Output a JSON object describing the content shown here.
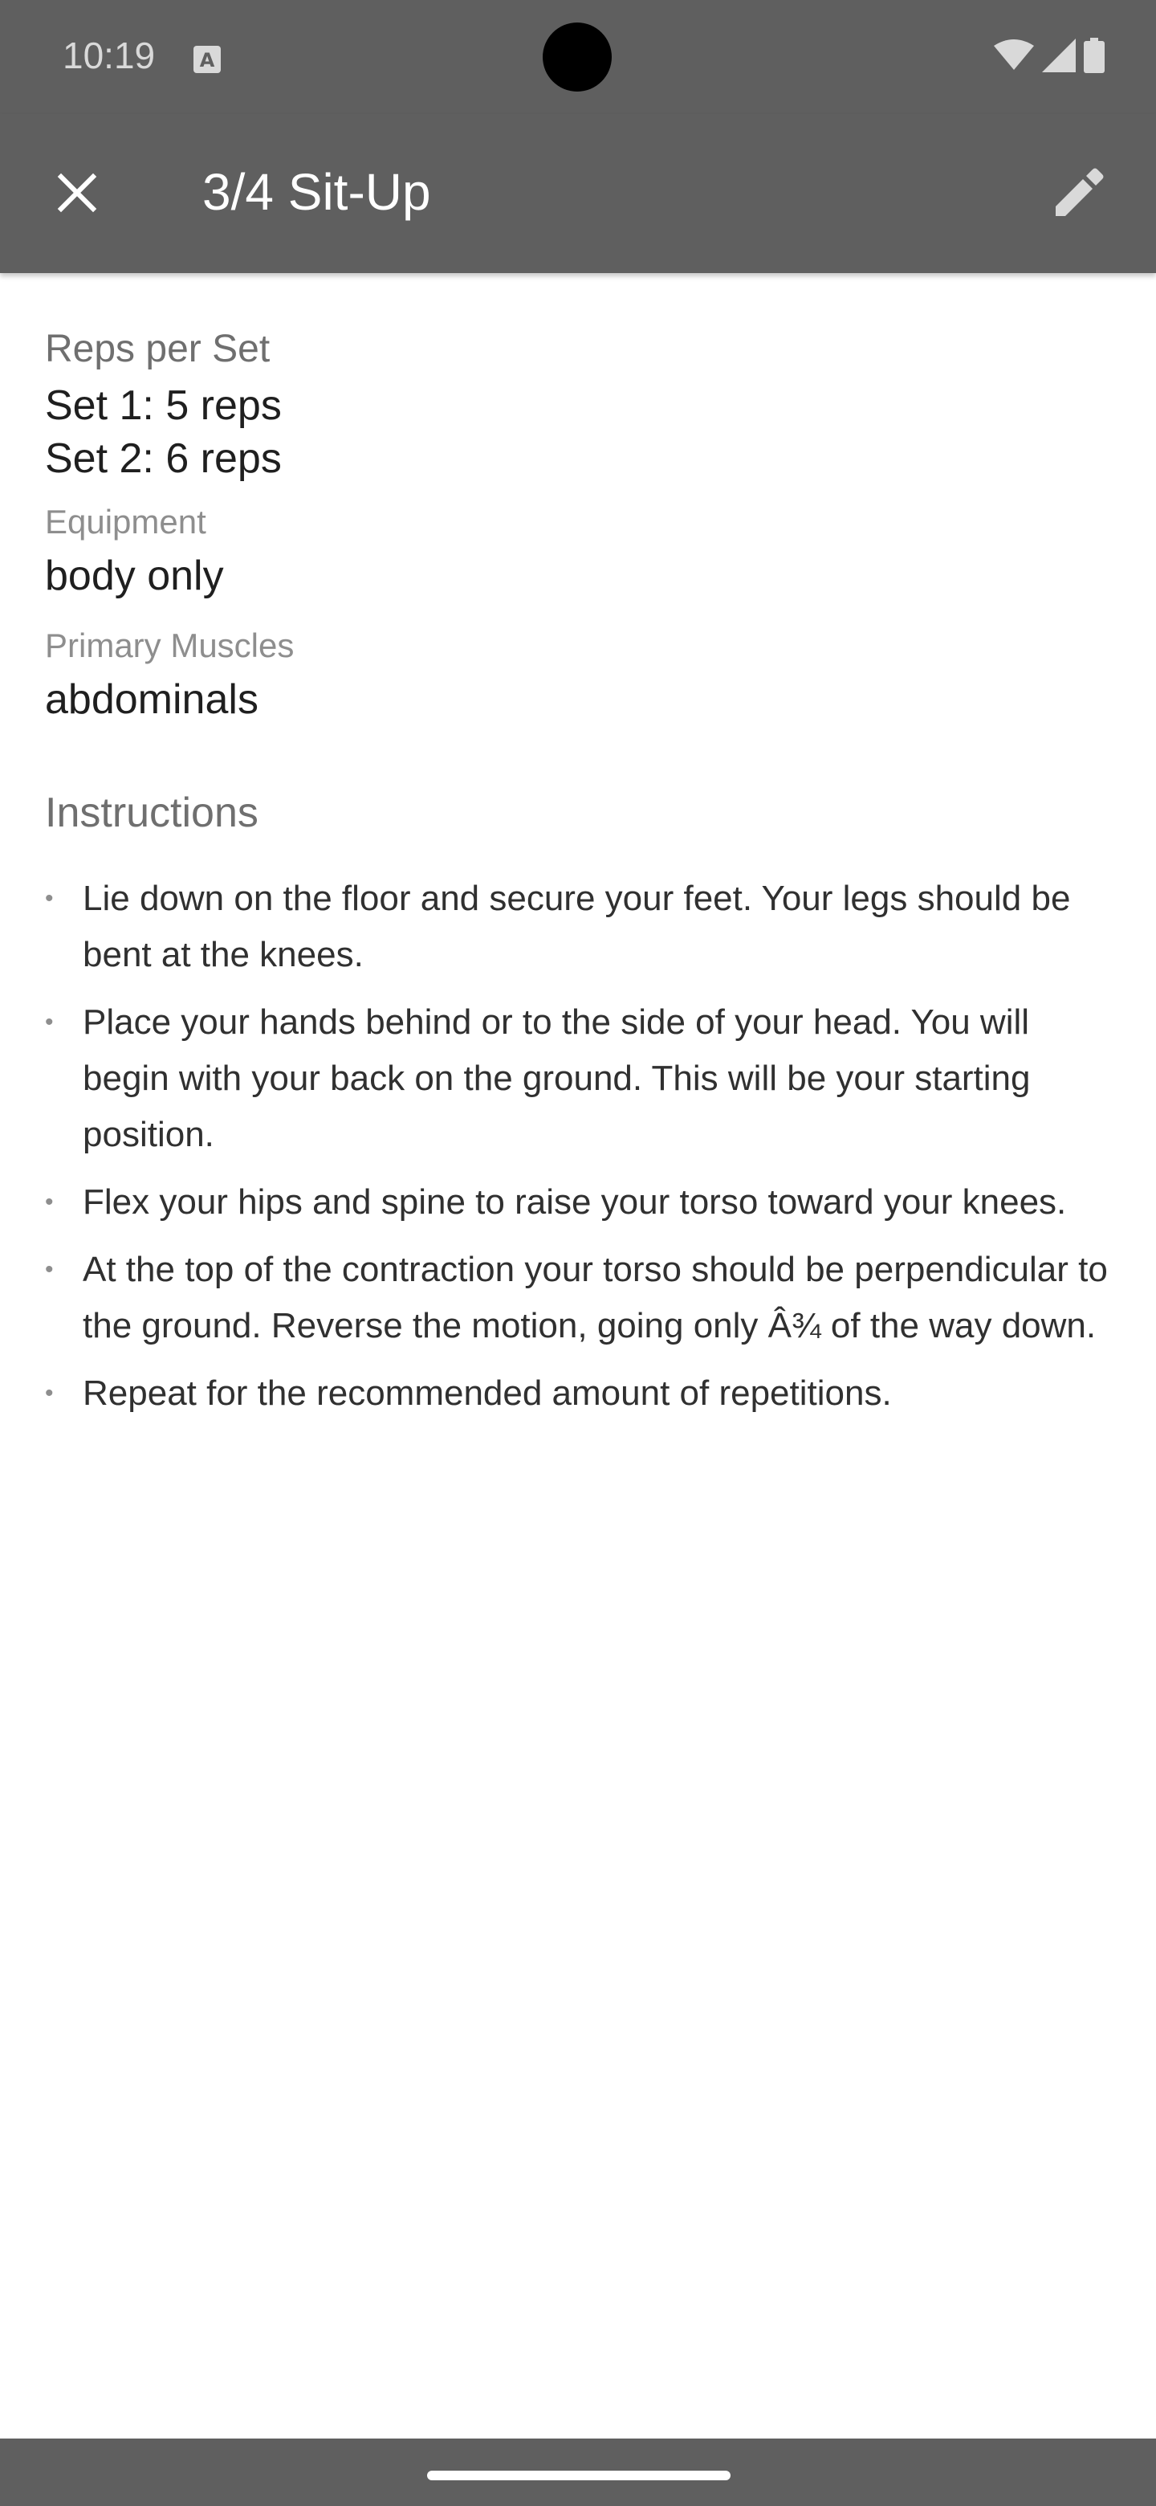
{
  "status_bar": {
    "time": "10:19",
    "icons": [
      "keyboard-a-icon",
      "wifi-icon",
      "cellular-signal-icon",
      "battery-icon"
    ]
  },
  "app_bar": {
    "title": "3/4 Sit-Up",
    "close_icon": "close-icon",
    "edit_icon": "edit-pencil-icon"
  },
  "details": {
    "reps_label": "Reps per Set",
    "sets": [
      "Set 1: 5 reps",
      "Set 2: 6 reps"
    ],
    "equipment_label": "Equipment",
    "equipment_value": "body only",
    "primary_muscles_label": "Primary Muscles",
    "primary_muscles_value": "abdominals"
  },
  "instructions": {
    "heading": "Instructions",
    "bullet": "•",
    "items": [
      "Lie down on the floor and secure your feet. Your legs should be bent at the knees.",
      "Place your hands behind or to the side of your head. You will begin with your back on the ground. This will be your starting position.",
      "Flex your hips and spine to raise your torso toward your knees.",
      "At the top of the contraction your torso should be perpendicular to the ground. Reverse the motion, going only Â¾ of the way down.",
      "Repeat for the recommended amount of repetitions."
    ]
  },
  "colors": {
    "app_bar": "#5f5f5f",
    "background": "#ffffff",
    "text_primary": "#1f1f1f",
    "text_secondary": "#6f6f6f"
  }
}
